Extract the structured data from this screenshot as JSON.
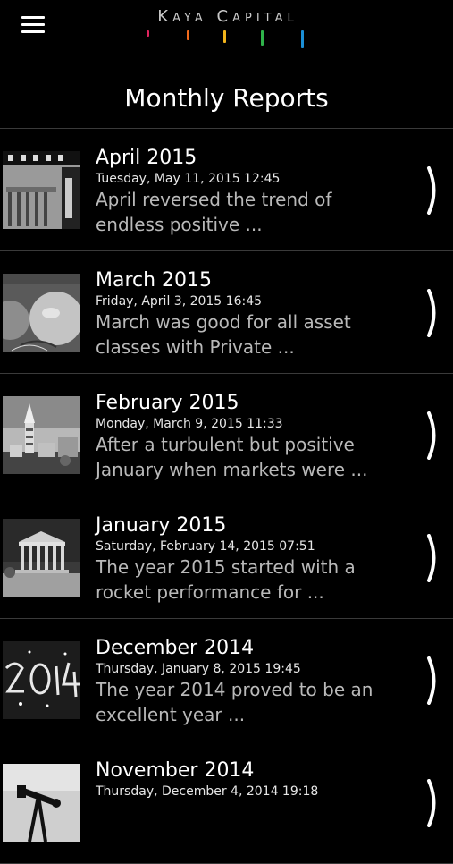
{
  "header": {
    "logo_text": "Kaya Capital",
    "logo_colors": [
      "#e0245e",
      "#f26a1b",
      "#f2b41b",
      "#2fb34a",
      "#1b8fd6"
    ],
    "menu_icon": "hamburger-menu-icon"
  },
  "page": {
    "title": "Monthly Reports"
  },
  "reports": [
    {
      "month": "April 2015",
      "date": "Tuesday, May 11, 2015 12:45",
      "excerpt_line1": "April reversed the trend of",
      "excerpt_line2": "endless positive ...",
      "thumb": "brandenburg-gate-photo"
    },
    {
      "month": "March 2015",
      "date": "Friday, April 3, 2015 16:45",
      "excerpt_line1": "March was good for all asset",
      "excerpt_line2": "classes with Private ...",
      "thumb": "balloons-photo"
    },
    {
      "month": "February 2015",
      "date": "Monday, March 9, 2015 11:33",
      "excerpt_line1": "After a turbulent but positive",
      "excerpt_line2": "January when markets were ...",
      "thumb": "moscow-skyline-photo"
    },
    {
      "month": "January 2015",
      "date": "Saturday, February 14, 2015 07:51",
      "excerpt_line1": "The year 2015 started with a",
      "excerpt_line2": "rocket performance for ...",
      "thumb": "parthenon-photo"
    },
    {
      "month": "December 2014",
      "date": "Thursday, January 8, 2015 19:45",
      "excerpt_line1": "The year 2014 proved to be an",
      "excerpt_line2": "excellent year ...",
      "thumb": "sparkler-2014-photo"
    },
    {
      "month": "November 2014",
      "date": "Thursday, December 4, 2014 19:18",
      "excerpt_line1": "",
      "excerpt_line2": "",
      "thumb": "oil-pump-photo"
    }
  ]
}
